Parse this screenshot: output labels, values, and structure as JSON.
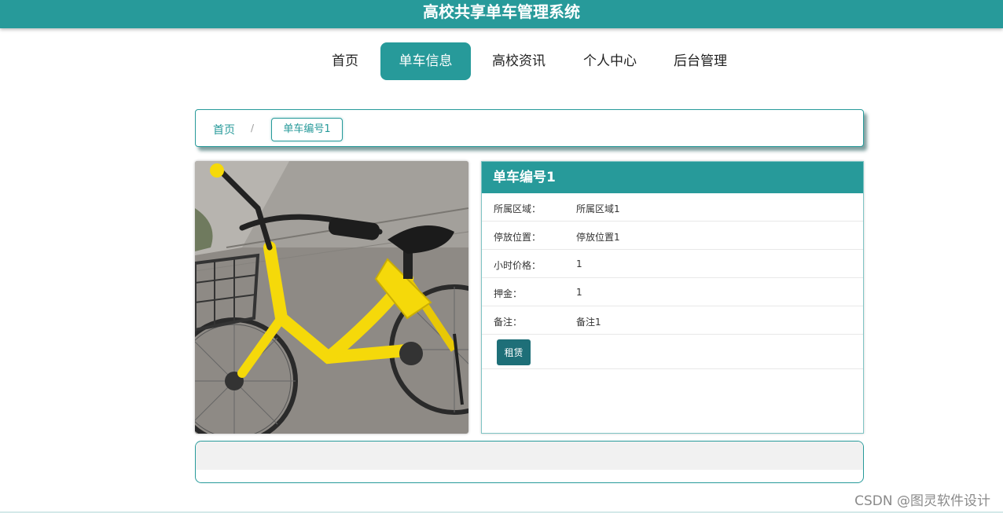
{
  "header": {
    "title": "高校共享单车管理系统"
  },
  "nav": {
    "items": [
      {
        "label": "首页",
        "active": false
      },
      {
        "label": "单车信息",
        "active": true
      },
      {
        "label": "高校资讯",
        "active": false
      },
      {
        "label": "个人中心",
        "active": false
      },
      {
        "label": "后台管理",
        "active": false
      }
    ]
  },
  "breadcrumb": {
    "home": "首页",
    "separator": "/",
    "current": "单车编号1"
  },
  "detail": {
    "title": "单车编号1",
    "fields": [
      {
        "label": "所属区域：",
        "value": "所属区域1"
      },
      {
        "label": "停放位置：",
        "value": "停放位置1"
      },
      {
        "label": "小时价格：",
        "value": "1"
      },
      {
        "label": "押金：",
        "value": "1"
      },
      {
        "label": "备注：",
        "value": "备注1"
      }
    ],
    "rent_button": "租赁"
  },
  "watermark": "CSDN @图灵软件设计",
  "colors": {
    "primary": "#279a9a",
    "button": "#1e6f78",
    "bike_yellow": "#f5d90a"
  }
}
